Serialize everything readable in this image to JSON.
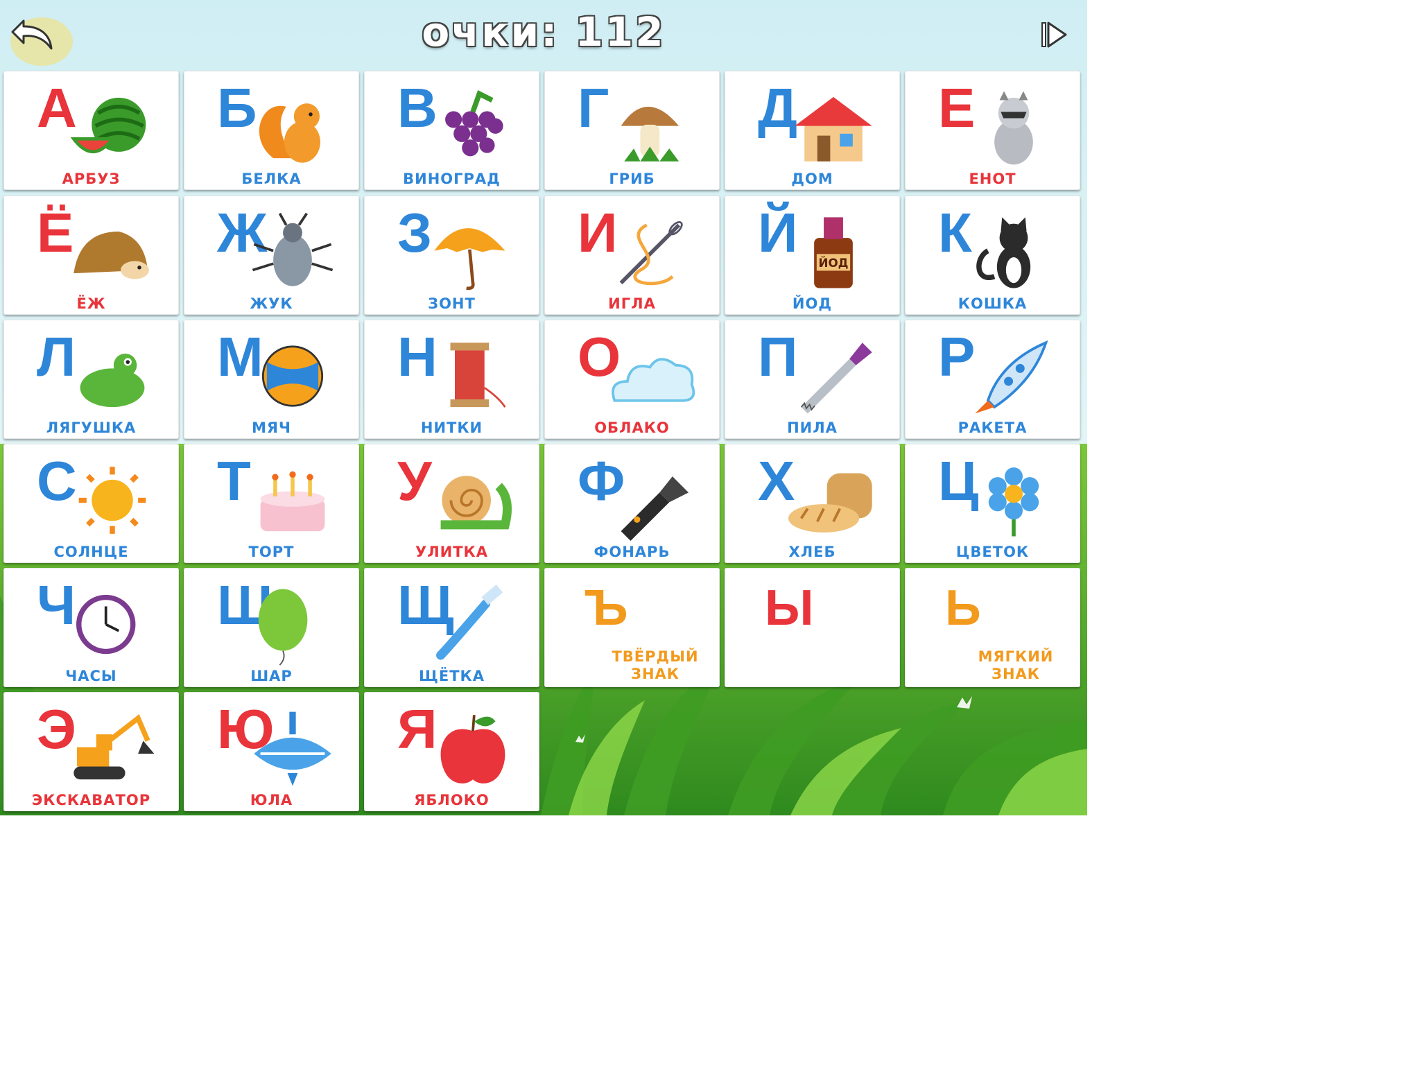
{
  "header": {
    "score_label": "очки:",
    "score_value": "112"
  },
  "colors": {
    "red": "#e8343a",
    "blue": "#2e86d9",
    "orange": "#f29a1d"
  },
  "cards": [
    {
      "letter": "А",
      "word": "АРБУЗ",
      "color": "red",
      "icon": "watermelon-icon"
    },
    {
      "letter": "Б",
      "word": "БЕЛКА",
      "color": "blue",
      "icon": "squirrel-icon"
    },
    {
      "letter": "В",
      "word": "ВИНОГРАД",
      "color": "blue",
      "icon": "grapes-icon"
    },
    {
      "letter": "Г",
      "word": "ГРИБ",
      "color": "blue",
      "icon": "mushroom-icon"
    },
    {
      "letter": "Д",
      "word": "ДОМ",
      "color": "blue",
      "icon": "house-icon"
    },
    {
      "letter": "Е",
      "word": "ЕНОТ",
      "color": "red",
      "icon": "raccoon-icon"
    },
    {
      "letter": "Ё",
      "word": "ЁЖ",
      "color": "red",
      "icon": "hedgehog-icon"
    },
    {
      "letter": "Ж",
      "word": "ЖУК",
      "color": "blue",
      "icon": "beetle-icon"
    },
    {
      "letter": "З",
      "word": "ЗОНТ",
      "color": "blue",
      "icon": "umbrella-icon"
    },
    {
      "letter": "И",
      "word": "ИГЛА",
      "color": "red",
      "icon": "needle-icon"
    },
    {
      "letter": "Й",
      "word": "ЙОД",
      "color": "blue",
      "icon": "iodine-bottle-icon",
      "icon_text": "ЙОД"
    },
    {
      "letter": "К",
      "word": "КОШКА",
      "color": "blue",
      "icon": "cat-icon"
    },
    {
      "letter": "Л",
      "word": "ЛЯГУШКА",
      "color": "blue",
      "icon": "frog-icon"
    },
    {
      "letter": "М",
      "word": "МЯЧ",
      "color": "blue",
      "icon": "ball-icon"
    },
    {
      "letter": "Н",
      "word": "НИТКИ",
      "color": "blue",
      "icon": "thread-spool-icon"
    },
    {
      "letter": "О",
      "word": "ОБЛАКО",
      "color": "red",
      "icon": "cloud-icon"
    },
    {
      "letter": "П",
      "word": "ПИЛА",
      "color": "blue",
      "icon": "saw-icon"
    },
    {
      "letter": "Р",
      "word": "РАКЕТА",
      "color": "blue",
      "icon": "rocket-icon"
    },
    {
      "letter": "С",
      "word": "СОЛНЦЕ",
      "color": "blue",
      "icon": "sun-icon"
    },
    {
      "letter": "Т",
      "word": "ТОРТ",
      "color": "blue",
      "icon": "cake-icon"
    },
    {
      "letter": "У",
      "word": "УЛИТКА",
      "color": "red",
      "icon": "snail-icon"
    },
    {
      "letter": "Ф",
      "word": "ФОНАРЬ",
      "color": "blue",
      "icon": "flashlight-icon"
    },
    {
      "letter": "Х",
      "word": "ХЛЕБ",
      "color": "blue",
      "icon": "bread-icon"
    },
    {
      "letter": "Ц",
      "word": "ЦВЕТОК",
      "color": "blue",
      "icon": "flower-icon"
    },
    {
      "letter": "Ч",
      "word": "ЧАСЫ",
      "color": "blue",
      "icon": "clock-icon"
    },
    {
      "letter": "Ш",
      "word": "ШАР",
      "color": "blue",
      "icon": "balloon-icon"
    },
    {
      "letter": "Щ",
      "word": "ЩЁТКА",
      "color": "blue",
      "icon": "toothbrush-icon"
    },
    {
      "letter": "Ъ",
      "word": "ТВЁРДЫЙ ЗНАК",
      "color": "orange",
      "icon": ""
    },
    {
      "letter": "Ы",
      "word": "",
      "color": "red",
      "icon": ""
    },
    {
      "letter": "Ь",
      "word": "МЯГКИЙ ЗНАК",
      "color": "orange",
      "icon": ""
    },
    {
      "letter": "Э",
      "word": "ЭКСКАВАТОР",
      "color": "red",
      "icon": "excavator-icon"
    },
    {
      "letter": "Ю",
      "word": "ЮЛА",
      "color": "red",
      "icon": "spinning-top-icon"
    },
    {
      "letter": "Я",
      "word": "ЯБЛОКО",
      "color": "red",
      "icon": "apple-icon"
    }
  ]
}
